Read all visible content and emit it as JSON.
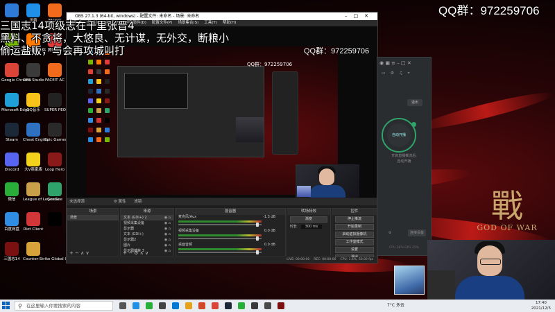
{
  "domain": "Computer-Use",
  "top_right_text": "QQ群：972259706",
  "overlay_lines": [
    "三国志14项级志在千里张晋4",
    "黑料、不贪将，大悠良、无计谋，无外交，断粮小",
    "偷运盐贩，与会再攻城叫打"
  ],
  "desktop_icons": [
    {
      "label": "",
      "color": "#2d7bd6"
    },
    {
      "label": "迅雷",
      "color": "#1f8fe8"
    },
    {
      "label": "FACEIT",
      "color": "#f26b1d"
    },
    {
      "label": "GeForce Experience",
      "color": "#76b900"
    },
    {
      "label": "斗鱼直播伴侣",
      "color": "#ff7a00"
    },
    {
      "label": "腾讯QQ",
      "color": "#e03a3a"
    },
    {
      "label": "Google Chrome",
      "color": "#db4437"
    },
    {
      "label": "OBS Studio",
      "color": "#3a3a3a"
    },
    {
      "label": "FACEIT AC",
      "color": "#f26b1d"
    },
    {
      "label": "Microsoft Edge",
      "color": "#1fa0d8"
    },
    {
      "label": "QQ音乐",
      "color": "#f7c21a"
    },
    {
      "label": "SUPER PEOPLE CBT",
      "color": "#222222"
    },
    {
      "label": "Steam",
      "color": "#1b2838"
    },
    {
      "label": "Cheat Engine",
      "color": "#3070c0"
    },
    {
      "label": "Epic Games Launcher",
      "color": "#2a2a2a"
    },
    {
      "label": "Discord",
      "color": "#5865f2"
    },
    {
      "label": "大V商家版",
      "color": "#f2d21a"
    },
    {
      "label": "Loop Hero",
      "color": "#8a1a1a"
    },
    {
      "label": "微信",
      "color": "#2aae3a"
    },
    {
      "label": "League of Legends",
      "color": "#c8a04a"
    },
    {
      "label": "GeeGee",
      "color": "#2ea36a"
    },
    {
      "label": "百度网盘",
      "color": "#2f8de4"
    },
    {
      "label": "Riot Client",
      "color": "#d13639"
    },
    {
      "label": "",
      "color": "#000000"
    },
    {
      "label": "三国志14",
      "color": "#7a1010"
    },
    {
      "label": "Counter-Strike Global Off...",
      "color": "#d8a23a"
    }
  ],
  "obs": {
    "title": "OBS 27.1.3 (64-bit, windows) - 配置文件: 未命名 - 场景: 未命名",
    "menu": [
      "文件(F)",
      "编辑(E)",
      "视图(V)",
      "停靠部件(D)",
      "配置文件(P)",
      "场景集合(S)",
      "工具(T)",
      "帮助(H)"
    ],
    "preview_qq": "QQ群：972259706",
    "nested_qq": "QQ群：972259706",
    "no_source_text": "未选择源",
    "props_btn": "⚙ 属性",
    "filters_btn": "滤镜",
    "panels": {
      "scenes": "场景",
      "sources": "来源",
      "mixer": "混音器",
      "transitions": "转场特效",
      "controls": "控件"
    },
    "scenes_items": [
      "场景"
    ],
    "sources_items": [
      "文本 (GDI+) 2",
      "视频采集设备",
      "显示器",
      "文本 (GDI+)",
      "显示器2",
      "图片",
      "显示器捕获 3"
    ],
    "mixer_items": [
      {
        "name": "麦克风/Aux",
        "db": "-1.3 dB"
      },
      {
        "name": "视频采集设备",
        "db": "0.0 dB"
      },
      {
        "name": "桌面音频",
        "db": "0.0 dB"
      }
    ],
    "transition_type": "渐变",
    "transition_duration_label": "时长",
    "transition_duration": "300 ms",
    "controls": [
      "停止推流",
      "开始录制",
      "启动虚拟摄像机",
      "工作室模式",
      "设置",
      "退出"
    ],
    "status": [
      "LIVE: 00:00:00",
      "REC: 00:00:00",
      "CPU: 1.6%, 60.00 fps"
    ]
  },
  "qqpanel": {
    "logout": "退出",
    "circle_text": "自动开播",
    "sub_lines": [
      "开启直播推流后,",
      "自动开播"
    ],
    "bottom_btn": "连接设备",
    "footer": "CPU 28%    GPU 25%"
  },
  "taskbar": {
    "search_placeholder": "在这里输入你要搜索的内容",
    "tray_text": "7°C 多云",
    "time": "17:40",
    "date": "2021/12/5",
    "app_colors": [
      "#555555",
      "#1f8fe8",
      "#2aae3a",
      "#444444",
      "#0078d4",
      "#e8a21a",
      "#d04a2a",
      "#db4437",
      "#1b2838",
      "#2aae3a",
      "#3a3a3a",
      "#4a4a4a",
      "#7a1010"
    ]
  }
}
